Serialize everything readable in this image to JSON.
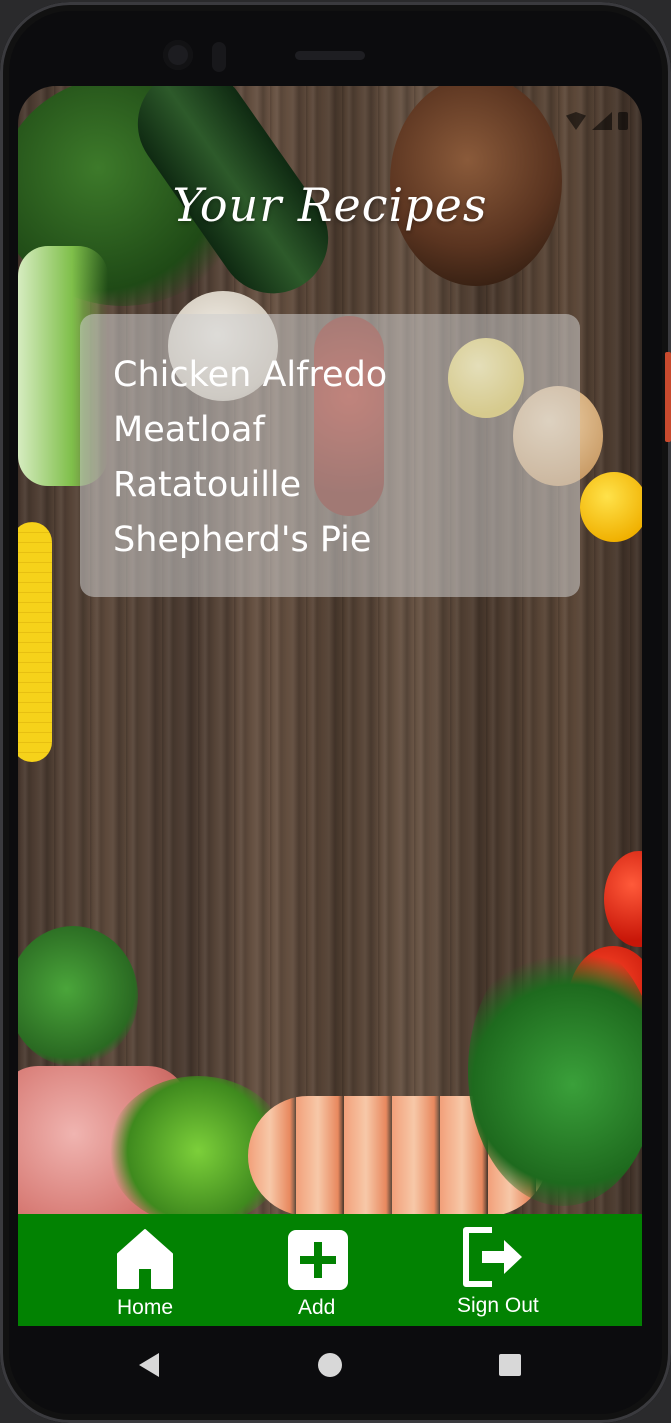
{
  "app": {
    "title": "Your Recipes"
  },
  "recipes": [
    {
      "name": "Chicken Alfredo"
    },
    {
      "name": "Meatloaf"
    },
    {
      "name": "Ratatouille"
    },
    {
      "name": "Shepherd's Pie"
    }
  ],
  "bottom_nav": {
    "items": [
      {
        "label": "Home",
        "icon": "home-icon"
      },
      {
        "label": "Add",
        "icon": "plus-icon"
      },
      {
        "label": "Sign Out",
        "icon": "sign-out-icon"
      }
    ]
  },
  "system_nav": {
    "buttons": [
      "back-icon",
      "home-circle-icon",
      "recents-icon"
    ]
  },
  "colors": {
    "nav_background": "#028202",
    "card_background": "rgba(205,205,205,0.55)",
    "text": "#ffffff"
  }
}
